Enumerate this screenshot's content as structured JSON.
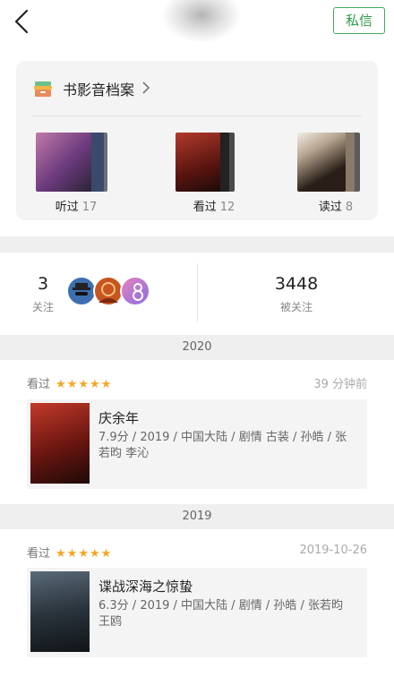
{
  "header": {
    "back_icon": "chevron-left-icon",
    "message_button": "私信",
    "accent_color": "#2f9a48"
  },
  "archive": {
    "title": "书影音档案",
    "chevron_icon": "chevron-right-icon",
    "shelves": [
      {
        "label": "听过",
        "count": "17"
      },
      {
        "label": "看过",
        "count": "12"
      },
      {
        "label": "读过",
        "count": "8"
      }
    ]
  },
  "follow": {
    "following_count": "3",
    "following_label": "关注",
    "followers_count": "3448",
    "followers_label": "被关注"
  },
  "timeline": [
    {
      "year": "2020",
      "action": "看过",
      "stars": "★★★★★",
      "time": "39 分钟前",
      "title": "庆余年",
      "meta": "7.9分 / 2019 / 中国大陆 / 剧情 古装 / 孙皓 / 张若昀 李沁"
    },
    {
      "year": "2019",
      "action": "看过",
      "stars": "★★★★★",
      "time": "2019-10-26",
      "title": "谍战深海之惊蛰",
      "meta": "6.3分 / 2019 / 中国大陆 / 剧情 / 孙皓 / 张若昀 王鸥"
    }
  ]
}
